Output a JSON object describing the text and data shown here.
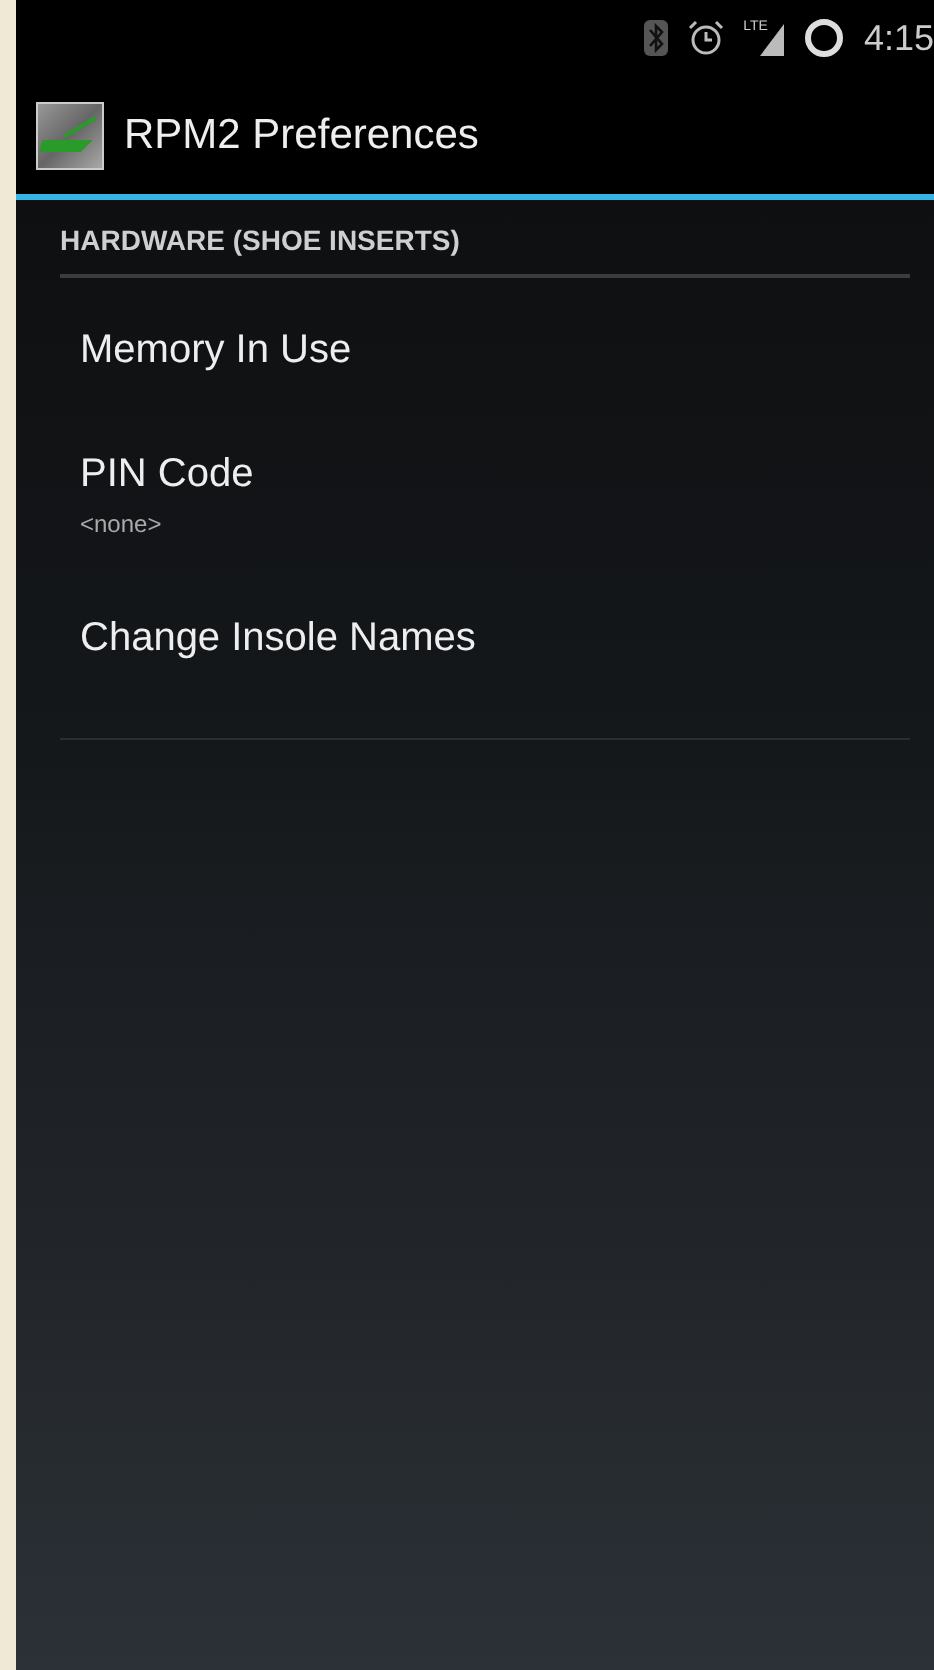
{
  "status_bar": {
    "time": "4:15",
    "network": "LTE"
  },
  "action_bar": {
    "title": "RPM2 Preferences"
  },
  "section": {
    "title": "HARDWARE (SHOE INSERTS)"
  },
  "preferences": [
    {
      "title": "Memory In Use"
    },
    {
      "title": "PIN Code",
      "summary": "<none>"
    },
    {
      "title": "Change Insole Names"
    }
  ]
}
